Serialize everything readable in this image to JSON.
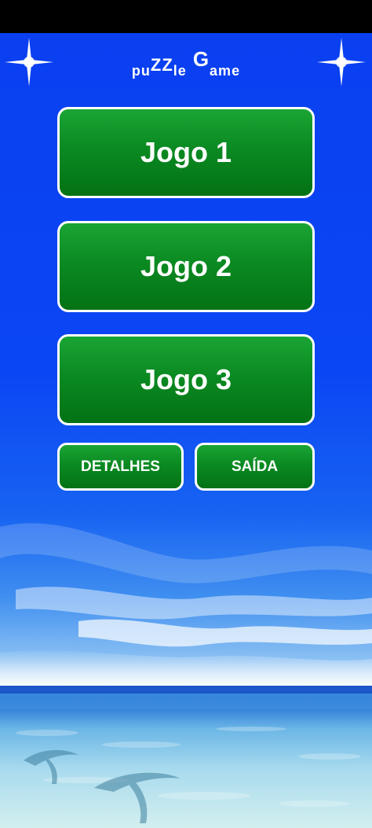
{
  "app": {
    "title_parts": [
      "pu",
      "ZZ",
      "le",
      "G",
      "ame"
    ]
  },
  "menu": {
    "game1_label": "Jogo 1",
    "game2_label": "Jogo 2",
    "game3_label": "Jogo 3",
    "details_label": "DETALHES",
    "exit_label": "SAÍDA"
  },
  "colors": {
    "background_blue": "#0b46f4",
    "button_green": "#0b8a22",
    "button_border": "#ffffff",
    "text": "#ffffff"
  },
  "icons": {
    "left_decoration": "sparkle-icon",
    "right_decoration": "sparkle-icon"
  }
}
